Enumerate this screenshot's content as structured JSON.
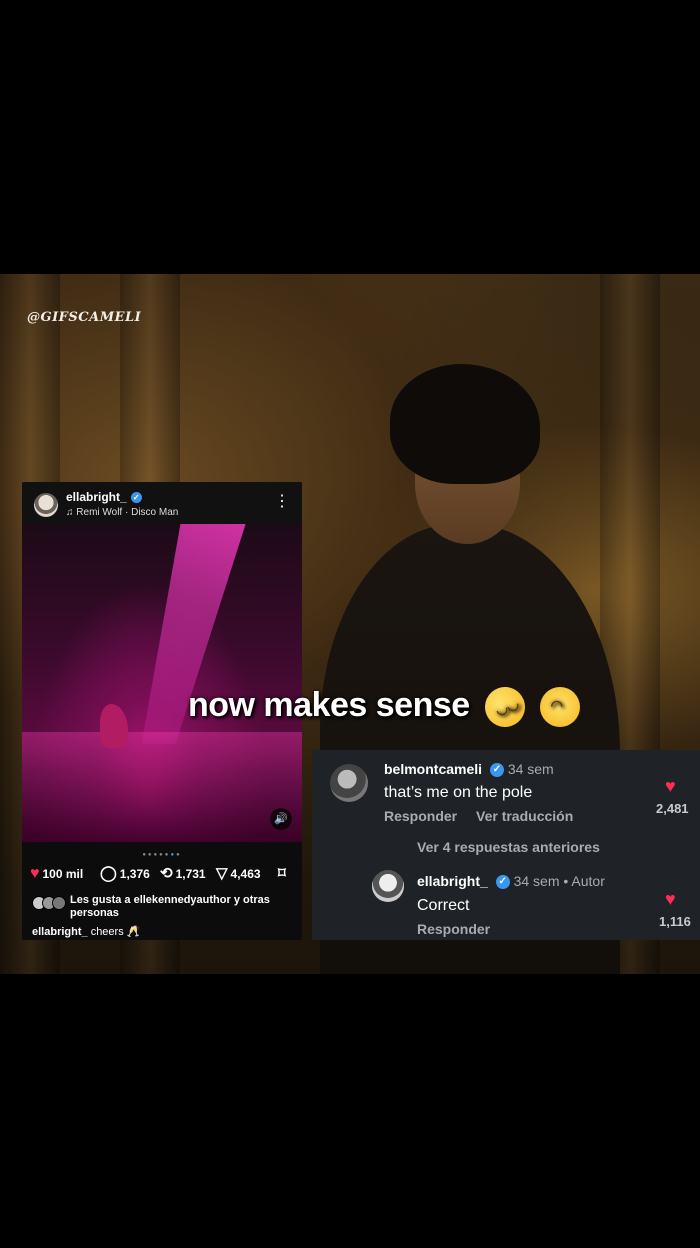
{
  "watermark": "@GIFSCAMELI",
  "overlay_caption": "now makes sense",
  "overlay_emojis": [
    "rolling-on-floor-laughing-emoji",
    "upside-down-face-emoji"
  ],
  "post": {
    "username": "ellabright_",
    "song": "Remi Wolf · Disco Man",
    "likes": "100 mil",
    "comments": "1,376",
    "reposts": "1,731",
    "shares": "4,463",
    "liked_by_prefix": "Les gusta a ",
    "liked_by_user": "ellekennedyauthor",
    "liked_by_suffix": " y otras personas",
    "caption_user": "ellabright_",
    "caption_text": "cheers 🥂",
    "heart_color": "#ff2d55",
    "verified_color": "#3897f0"
  },
  "comments": {
    "items": [
      {
        "username": "belmontcameli",
        "time": "34 sem",
        "text": "that’s me on the pole",
        "reply_label": "Responder",
        "translate_label": "Ver traducción",
        "likes": "2,481"
      },
      {
        "username": "ellabright_",
        "time": "34 sem",
        "author_tag": "• Autor",
        "text": "Correct",
        "reply_label": "Responder",
        "likes": "1,116"
      }
    ],
    "view_replies": "Ver 4 respuestas anteriores"
  }
}
